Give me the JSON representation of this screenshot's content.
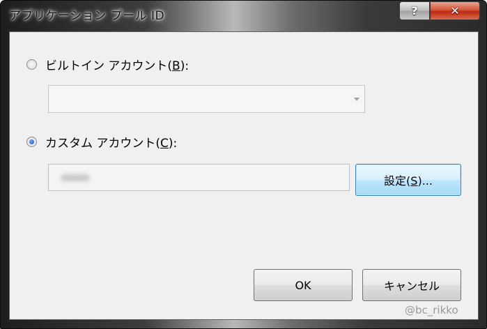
{
  "window": {
    "title": "アプリケーション プール ID",
    "help_glyph": "?",
    "close_glyph": "✕"
  },
  "builtin_account": {
    "label_before": "ビルトイン アカウント(",
    "accelerator": "B",
    "label_after": "):",
    "selected": false,
    "dropdown_value": ""
  },
  "custom_account": {
    "label_before": "カスタム アカウント(",
    "accelerator": "C",
    "label_after": "):",
    "selected": true,
    "field_value": ""
  },
  "buttons": {
    "set_label_before": "設定(",
    "set_accelerator": "S",
    "set_label_after": ")...",
    "ok": "OK",
    "cancel": "キャンセル"
  },
  "watermark": "@bc_rikko",
  "icons": {
    "help": "question-icon",
    "close": "close-icon",
    "dropdown": "chevron-down-icon"
  }
}
